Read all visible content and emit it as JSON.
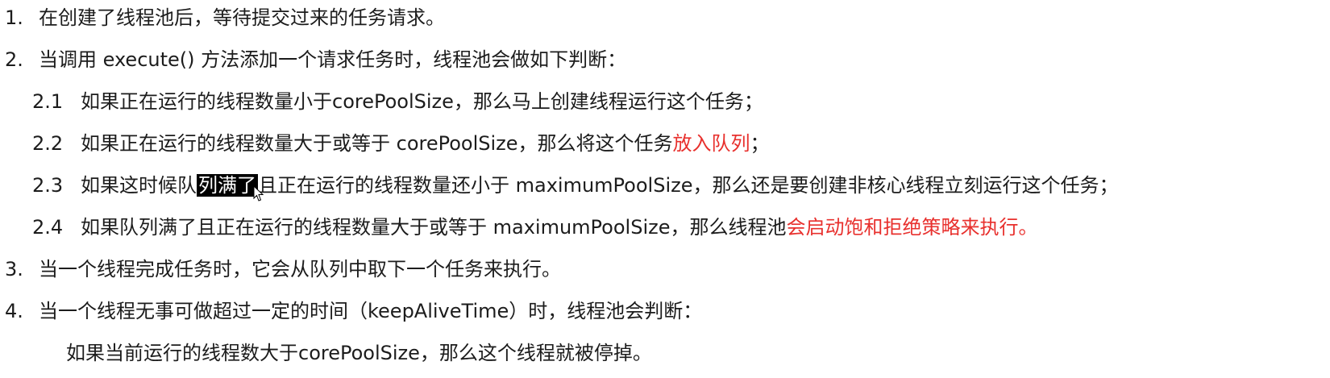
{
  "items": [
    {
      "num": "1.",
      "text": "在创建了线程池后，等待提交过来的任务请求。"
    },
    {
      "num": "2.",
      "text": "当调用 execute() 方法添加一个请求任务时，线程池会做如下判断："
    },
    {
      "num": "2.1",
      "text": "如果正在运行的线程数量小于corePoolSize，那么马上创建线程运行这个任务；"
    },
    {
      "num": "2.2",
      "text_a": "如果正在运行的线程数量大于或等于 corePoolSize，那么将这个任务",
      "text_red": "放入队列",
      "text_b": "；"
    },
    {
      "num": "2.3",
      "text_a": "如果这时候队",
      "text_hl": "列满了",
      "text_b": "且正在运行的线程数量还小于 maximumPoolSize，那么还是要创建非核心线程立刻运行这个任务；"
    },
    {
      "num": "2.4",
      "text_a": "如果队列满了且正在运行的线程数量大于或等于 maximumPoolSize，那么线程池",
      "text_red": "会启动饱和拒绝策略来执行。"
    },
    {
      "num": "3.",
      "text": "当一个线程完成任务时，它会从队列中取下一个任务来执行。"
    },
    {
      "num": "4.",
      "text": "当一个线程无事可做超过一定的时间（keepAliveTime）时，线程池会判断："
    },
    {
      "num": "",
      "text": "如果当前运行的线程数大于corePoolSize，那么这个线程就被停掉。"
    }
  ],
  "colors": {
    "text": "#1c1c1c",
    "highlight_red": "#e8302d",
    "selection_bg": "#000000",
    "selection_fg": "#ffffff"
  },
  "icons": {
    "cursor": "mouse-pointer-icon"
  }
}
